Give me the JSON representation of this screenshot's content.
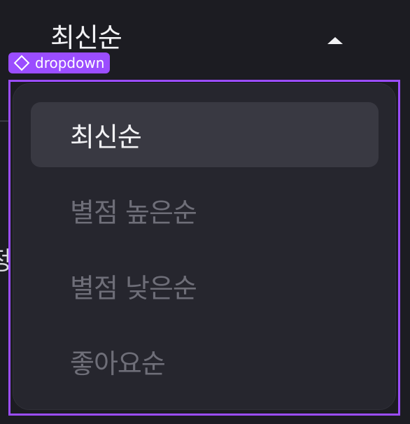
{
  "header": {
    "selected_label": "최신순"
  },
  "edge": {
    "glyph": "정"
  },
  "overlay": {
    "tag_label": "dropdown"
  },
  "dropdown": {
    "options": [
      {
        "label": "최신순",
        "selected": true
      },
      {
        "label": "별점 높은순",
        "selected": false
      },
      {
        "label": "별점 낮은순",
        "selected": false
      },
      {
        "label": "좋아요순",
        "selected": false
      }
    ]
  }
}
